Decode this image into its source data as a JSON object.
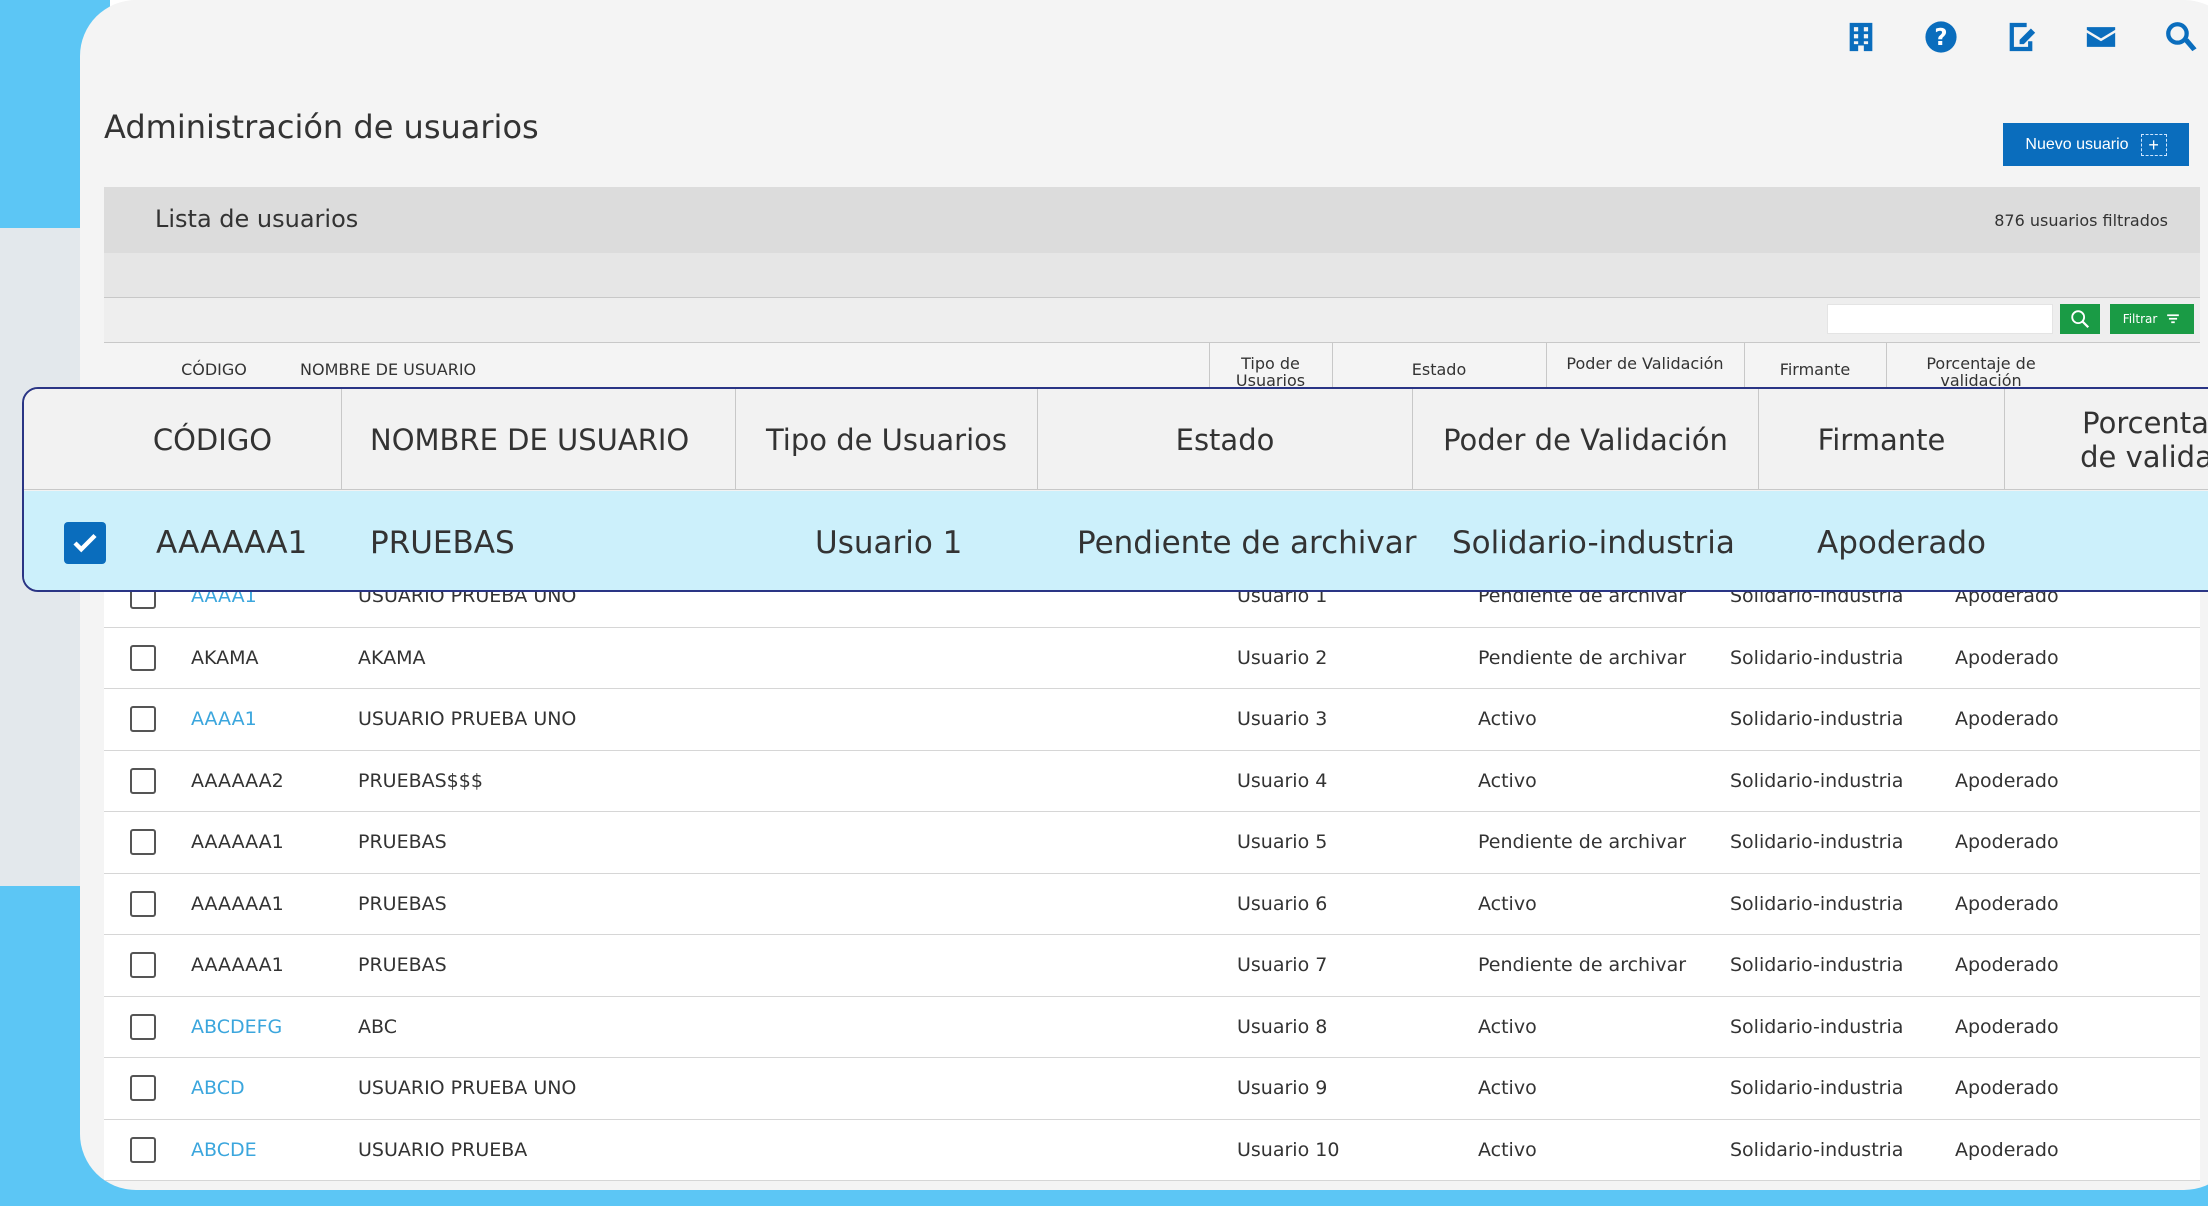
{
  "header": {
    "title": "Administración de usuarios",
    "new_user_label": "Nuevo usuario",
    "icons": [
      "building-icon",
      "help-icon",
      "edit-icon",
      "mail-icon",
      "search-icon"
    ]
  },
  "list": {
    "title": "Lista de usuarios",
    "count": "876 usuarios filtrados",
    "filter_label": "Filtrar",
    "search_placeholder": ""
  },
  "columns": {
    "code": "CÓDIGO",
    "name": "NOMBRE DE USUARIO",
    "type": "Tipo de Usuarios",
    "state": "Estado",
    "power": "Poder de Validación",
    "signer": "Firmante",
    "percent": "Porcentaje de validación"
  },
  "zoom": {
    "headers": {
      "code": "CÓDIGO",
      "name": "NOMBRE DE USUARIO",
      "type": "Tipo de Usuarios",
      "state": "Estado",
      "power": "Poder de Validación",
      "signer": "Firmante",
      "percent": "Porcentaje de validaci"
    },
    "row": {
      "checked": true,
      "code": "AAAAAA1",
      "name": "PRUEBAS",
      "type": "Usuario 1",
      "state": "Pendiente de archivar",
      "power": "Solidario-industria",
      "signer": "Apoderado"
    }
  },
  "rows": [
    {
      "code": "AAAA1",
      "link": true,
      "name": "USUARIO PRUEBA UNO",
      "type": "Usuario 1",
      "state": "Pendiente de archivar",
      "power": "Solidario-industria",
      "signer": "Apoderado"
    },
    {
      "code": "AKAMA",
      "link": false,
      "name": "AKAMA",
      "type": "Usuario 2",
      "state": "Pendiente de archivar",
      "power": "Solidario-industria",
      "signer": "Apoderado"
    },
    {
      "code": "AAAA1",
      "link": true,
      "name": "USUARIO PRUEBA UNO",
      "type": "Usuario 3",
      "state": "Activo",
      "power": "Solidario-industria",
      "signer": "Apoderado"
    },
    {
      "code": "AAAAAA2",
      "link": false,
      "name": "PRUEBAS$$$",
      "type": "Usuario 4",
      "state": "Activo",
      "power": "Solidario-industria",
      "signer": "Apoderado"
    },
    {
      "code": "AAAAAA1",
      "link": false,
      "name": "PRUEBAS",
      "type": "Usuario 5",
      "state": "Pendiente de archivar",
      "power": "Solidario-industria",
      "signer": "Apoderado"
    },
    {
      "code": "AAAAAA1",
      "link": false,
      "name": "PRUEBAS",
      "type": "Usuario 6",
      "state": "Activo",
      "power": "Solidario-industria",
      "signer": "Apoderado"
    },
    {
      "code": "AAAAAA1",
      "link": false,
      "name": "PRUEBAS",
      "type": "Usuario 7",
      "state": "Pendiente de archivar",
      "power": "Solidario-industria",
      "signer": "Apoderado"
    },
    {
      "code": "ABCDEFG",
      "link": true,
      "name": "ABC",
      "type": "Usuario 8",
      "state": "Activo",
      "power": "Solidario-industria",
      "signer": "Apoderado"
    },
    {
      "code": "ABCD",
      "link": true,
      "name": "USUARIO PRUEBA UNO",
      "type": "Usuario 9",
      "state": "Activo",
      "power": "Solidario-industria",
      "signer": "Apoderado"
    },
    {
      "code": "ABCDE",
      "link": true,
      "name": "USUARIO PRUEBA",
      "type": "Usuario 10",
      "state": "Activo",
      "power": "Solidario-industria",
      "signer": "Apoderado"
    }
  ],
  "colors": {
    "primary": "#0a6dbd",
    "accent_green": "#1a9b45",
    "link": "#3ba6dd",
    "highlight_row": "#ccf0fb",
    "overlay_border": "#2a3585",
    "background_blue": "#5cc6f5"
  }
}
